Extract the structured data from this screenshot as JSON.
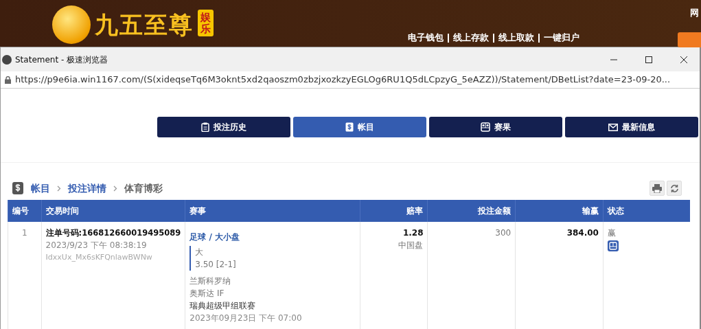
{
  "site_header": {
    "logo_text": "九五至尊",
    "logo_badge": "娱乐",
    "links": [
      "电子钱包",
      "线上存款",
      "线上取款",
      "一键归户"
    ],
    "corner_text": "网"
  },
  "window": {
    "title": "Statement - 极速浏览器",
    "url": "https://p9e6ia.win1167.com/(S(xideqseTq6M3oknt5xd2qaoszm0zbzjxozkzyEGLOg6RU1Q5dLCpzyG_5eAZZ))/Statement/DBetList?date=23-09-20..."
  },
  "nav_tabs": [
    {
      "label": "投注历史",
      "selected": false
    },
    {
      "label": "帐目",
      "selected": true
    },
    {
      "label": "赛果",
      "selected": false
    },
    {
      "label": "最新信息",
      "selected": false
    }
  ],
  "breadcrumb": [
    "帐目",
    "投注详情",
    "体育博彩"
  ],
  "table": {
    "columns": [
      "编号",
      "交易时间",
      "赛事",
      "赔率",
      "投注金额",
      "输赢",
      "状态"
    ],
    "rows": [
      {
        "number": "1",
        "ticket": "注单号码:166812660019495089",
        "time": "2023/9/23 下午 08:38:19",
        "ref": "IdxxUx_Mx6sKFQnlawBWNw",
        "sport": "足球 / 大小盘",
        "pick": "大",
        "line": "3.50 [2-1]",
        "home": "兰斯科罗纳",
        "away": "奥斯达 IF",
        "league": "瑞典超级甲组联赛",
        "match_time": "2023年09月23日 下午 07:00",
        "odds": "1.28",
        "odds_type": "中国盘",
        "stake": "300",
        "result": "384.00",
        "status": "赢"
      }
    ]
  }
}
